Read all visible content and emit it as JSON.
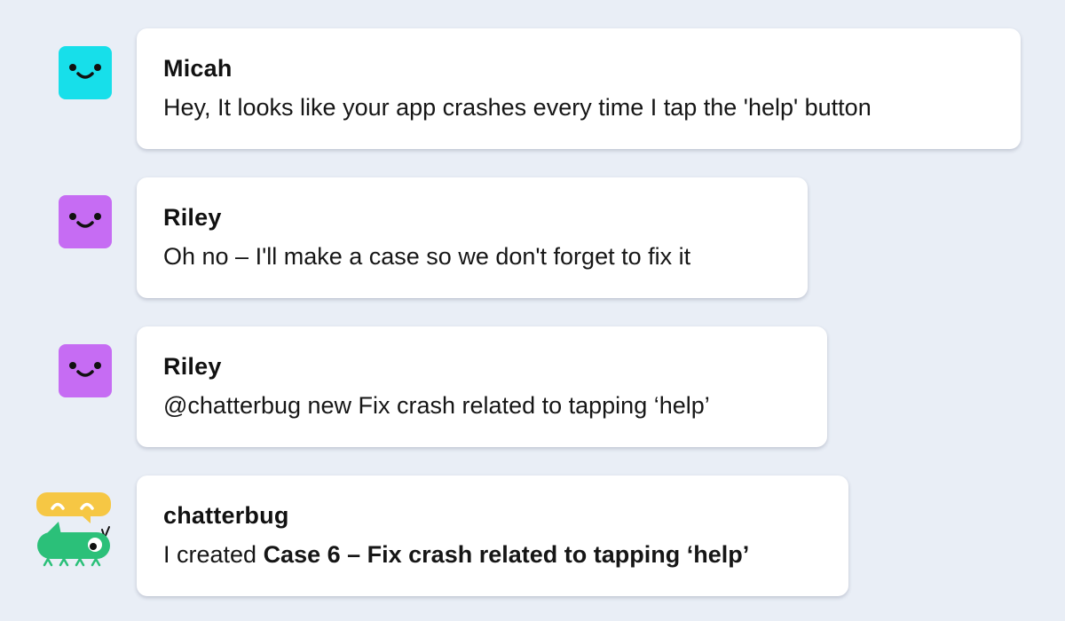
{
  "colors": {
    "background": "#e9eef6",
    "micah_avatar": "#17dfea",
    "riley_avatar": "#c66cf3",
    "bot_green": "#2bc079",
    "bot_speech": "#f6c744"
  },
  "messages": [
    {
      "author": "Micah",
      "avatar": "smiley-face-icon",
      "text": "Hey, It looks like your app crashes every time I tap the 'help' button"
    },
    {
      "author": "Riley",
      "avatar": "smiley-face-icon",
      "text": "Oh no – I'll make a case so we don't forget to fix it"
    },
    {
      "author": "Riley",
      "avatar": "smiley-face-icon",
      "text": "@chatterbug new Fix crash related to tapping ‘help’"
    },
    {
      "author": "chatterbug",
      "avatar": "chatterbug-bot-icon",
      "text_prefix": "I created ",
      "text_bold": "Case 6 – Fix crash related to tapping ‘help’"
    }
  ]
}
